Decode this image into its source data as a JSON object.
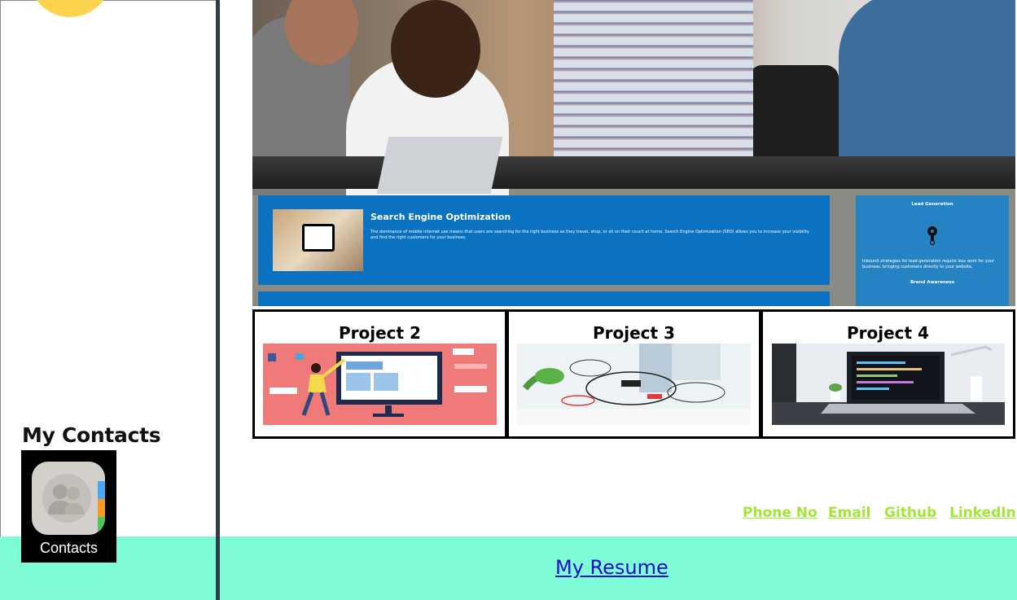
{
  "sidebar": {
    "contacts_heading": "My Contacts",
    "contacts_app_label": "Contacts"
  },
  "hero": {
    "seo_title": "Search Engine Optimization",
    "seo_text": "The dominance of mobile internet use means that users are searching for the right business as they travel, shop, or sit on their couch at home. Search Engine Optimization (SEO) allows you to increase your visibility and find the right customers for your business.",
    "lead_title": "Lead Generation",
    "lead_text": "Inbound strategies for lead generation require less work for your business, bringing customers directly to your website.",
    "brand_title": "Brand Awareness"
  },
  "projects": [
    {
      "title": "Project 2"
    },
    {
      "title": "Project 3"
    },
    {
      "title": "Project 4"
    }
  ],
  "links": {
    "phone": "Phone No",
    "email": "Email",
    "github": "Github",
    "linkedin": "LinkedIn"
  },
  "footer": {
    "resume": "My Resume"
  },
  "colors": {
    "footer_bg": "#7dfcd6",
    "link_color": "#a3e635",
    "resume_link": "#1a0dcc",
    "divider": "#2f3e4b",
    "seo_blue": "#0a72c0"
  }
}
